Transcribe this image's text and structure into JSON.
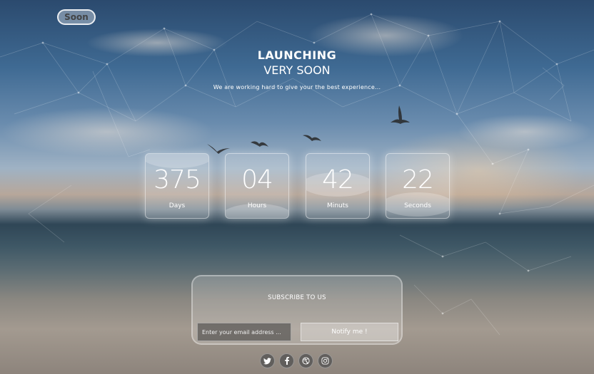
{
  "logo": {
    "text": "Soon"
  },
  "heading": {
    "line1": "LAUNCHING",
    "line2": "VERY SOON",
    "subtitle": "We are working hard to give your the best experience..."
  },
  "countdown": [
    {
      "value": "375",
      "label": "Days"
    },
    {
      "value": "04",
      "label": "Hours"
    },
    {
      "value": "42",
      "label": "Minuts"
    },
    {
      "value": "22",
      "label": "Seconds"
    }
  ],
  "subscribe": {
    "title": "SUBSCRIBE TO US",
    "email_placeholder": "Enter your email address ...",
    "button_label": "Notify me !"
  },
  "socials": [
    {
      "icon": "twitter-icon"
    },
    {
      "icon": "facebook-icon"
    },
    {
      "icon": "dribbble-icon"
    },
    {
      "icon": "instagram-icon"
    }
  ],
  "colors": {
    "text": "#ffffff",
    "card_bg": "rgba(255,255,255,0.18)",
    "social_bg": "#505050"
  }
}
